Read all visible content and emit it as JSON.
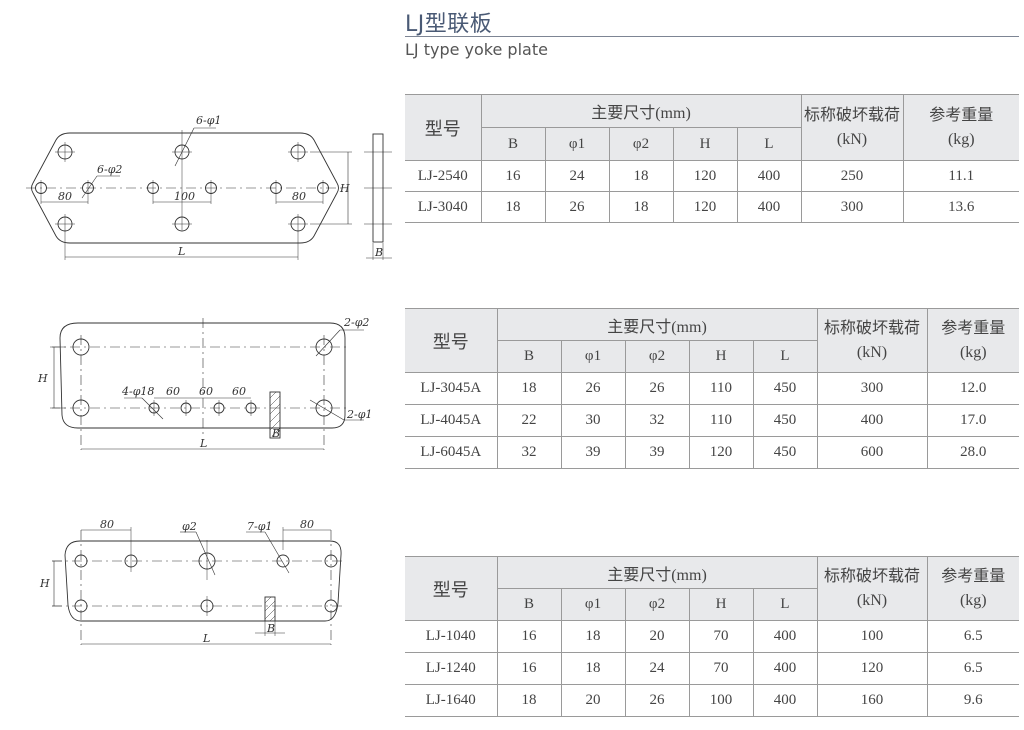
{
  "header": {
    "title": "LJ型联板",
    "subtitle": "LJ type yoke plate"
  },
  "table_headers": {
    "model": "型号",
    "main_dims": "主要尺寸(mm)",
    "dims": [
      "B",
      "φ1",
      "φ2",
      "H",
      "L"
    ],
    "load_line1": "标称破坏载荷",
    "load_line2": "(kN)",
    "weight_line1": "参考重量",
    "weight_line2": "(kg)"
  },
  "tables": [
    {
      "rows": [
        {
          "model": "LJ-2540",
          "B": "16",
          "phi1": "24",
          "phi2": "18",
          "H": "120",
          "L": "400",
          "load": "250",
          "weight": "11.1"
        },
        {
          "model": "LJ-3040",
          "B": "18",
          "phi1": "26",
          "phi2": "18",
          "H": "120",
          "L": "400",
          "load": "300",
          "weight": "13.6"
        }
      ]
    },
    {
      "rows": [
        {
          "model": "LJ-3045A",
          "B": "18",
          "phi1": "26",
          "phi2": "26",
          "H": "110",
          "L": "450",
          "load": "300",
          "weight": "12.0"
        },
        {
          "model": "LJ-4045A",
          "B": "22",
          "phi1": "30",
          "phi2": "32",
          "H": "110",
          "L": "450",
          "load": "400",
          "weight": "17.0"
        },
        {
          "model": "LJ-6045A",
          "B": "32",
          "phi1": "39",
          "phi2": "39",
          "H": "120",
          "L": "450",
          "load": "600",
          "weight": "28.0"
        }
      ]
    },
    {
      "rows": [
        {
          "model": "LJ-1040",
          "B": "16",
          "phi1": "18",
          "phi2": "20",
          "H": "70",
          "L": "400",
          "load": "100",
          "weight": "6.5"
        },
        {
          "model": "LJ-1240",
          "B": "16",
          "phi1": "18",
          "phi2": "24",
          "H": "70",
          "L": "400",
          "load": "120",
          "weight": "6.5"
        },
        {
          "model": "LJ-1640",
          "B": "18",
          "phi1": "20",
          "phi2": "26",
          "H": "100",
          "L": "400",
          "load": "160",
          "weight": "9.6"
        }
      ]
    }
  ],
  "drawings": [
    {
      "labels": {
        "phi1_callout": "6-φ1",
        "phi2_callout": "6-φ2",
        "dim_left": "80",
        "dim_center": "100",
        "dim_right": "80",
        "H": "H",
        "L": "L",
        "B": "B"
      }
    },
    {
      "labels": {
        "phi2_callout": "2-φ2",
        "phi1_callout": "2-φ1",
        "small_holes": "4-φ18",
        "pitch1": "60",
        "pitch2": "60",
        "pitch3": "60",
        "H": "H",
        "L": "L",
        "B": "B"
      }
    },
    {
      "labels": {
        "dim_left": "80",
        "dim_right": "80",
        "phi2_callout": "φ2",
        "phi1_callout": "7-φ1",
        "H": "H",
        "L": "L",
        "B": "B"
      }
    }
  ]
}
